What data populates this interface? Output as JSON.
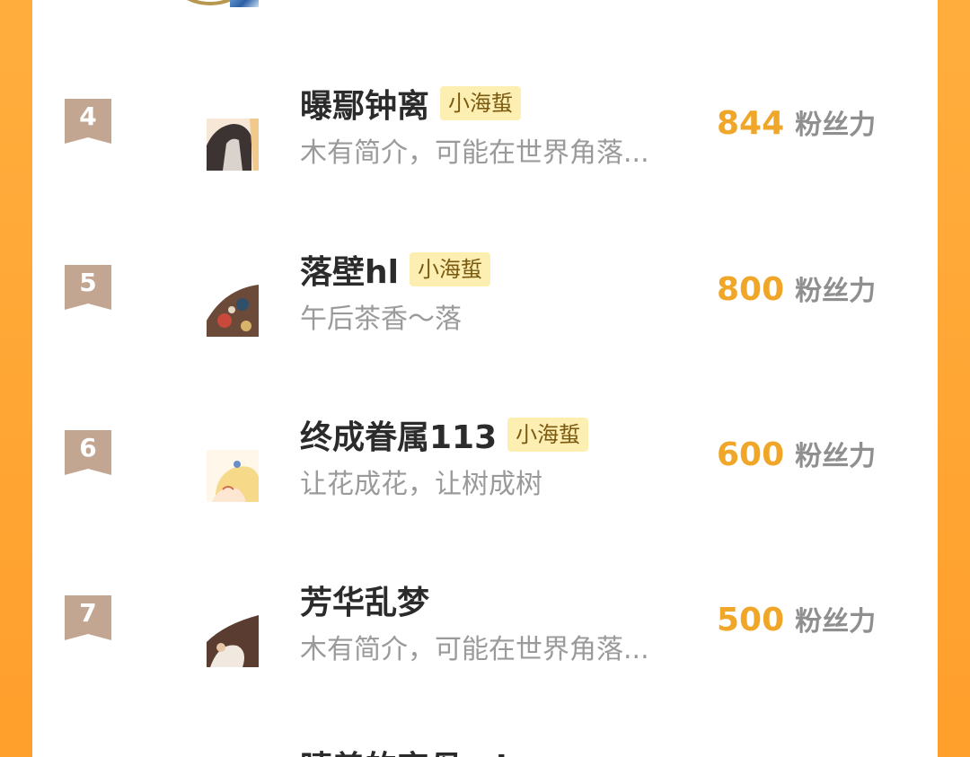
{
  "list": {
    "unit_label": "粉丝力",
    "items": [
      {
        "rank": "4",
        "name": "曝鄢钟离",
        "badge": "小海蜇",
        "desc": "木有简介，可能在世界角落...",
        "score": "844"
      },
      {
        "rank": "5",
        "name": "落壁hl",
        "badge": "小海蜇",
        "desc": "午后茶香～落",
        "score": "800"
      },
      {
        "rank": "6",
        "name": "终成眷属113",
        "badge": "小海蜇",
        "desc": "让花成花，让树成树",
        "score": "600"
      },
      {
        "rank": "7",
        "name": "芳华乱梦",
        "badge": "",
        "desc": "木有简介，可能在世界角落...",
        "score": "500"
      }
    ],
    "next_item_name": "晴善的字母 nl..."
  }
}
